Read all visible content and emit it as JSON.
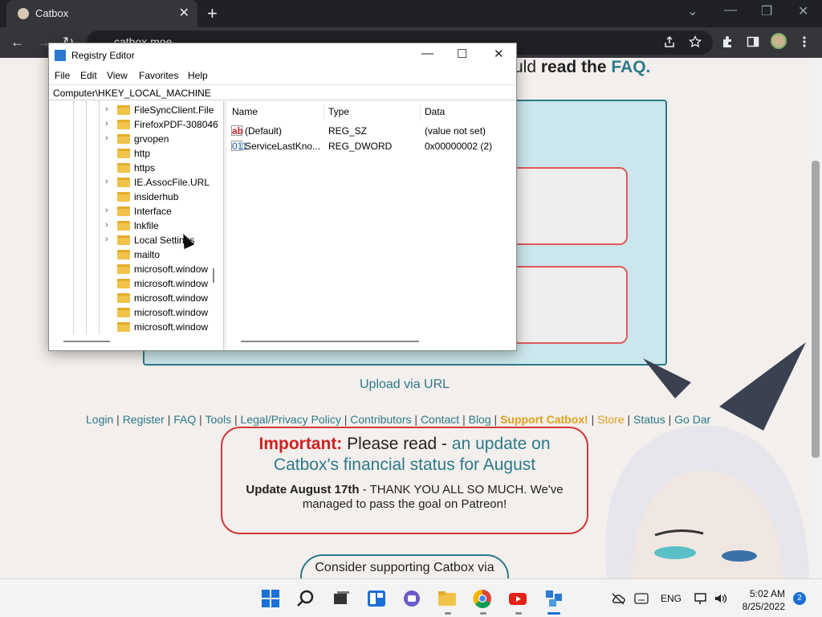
{
  "browser": {
    "tab_title": "Catbox",
    "tab_close": "✕",
    "new_tab": "+",
    "url": "catbox.moe",
    "controls": {
      "minimize": "—",
      "restore": "❐",
      "close": "✕",
      "tab_search": "⌄"
    },
    "toolbar": {
      "back": "←",
      "forward": "→",
      "reload": "↻"
    }
  },
  "page": {
    "faq_prefix": "uld ",
    "faq_bold": "read the ",
    "faq_link": "FAQ.",
    "upload_url": "Upload via URL",
    "links": [
      {
        "label": "Login",
        "kind": "l"
      },
      {
        "label": "Register",
        "kind": "l"
      },
      {
        "label": "FAQ",
        "kind": "l"
      },
      {
        "label": "Tools",
        "kind": "l"
      },
      {
        "label": "Legal/Privacy Policy",
        "kind": "l"
      },
      {
        "label": "Contributors",
        "kind": "l"
      },
      {
        "label": "Contact",
        "kind": "l"
      },
      {
        "label": "Blog",
        "kind": "l"
      },
      {
        "label": "Support Catbox!",
        "kind": "s"
      },
      {
        "label": "Store",
        "kind": "st"
      },
      {
        "label": "Status",
        "kind": "l"
      },
      {
        "label": "Go Dar",
        "kind": "l"
      }
    ],
    "important": {
      "label": "Important:",
      "text": " Please read - ",
      "link": "an update on Catbox's financial status for August",
      "update_bold": "Update August 17th",
      "update_text": " - THANK YOU ALL SO MUCH. We've managed to pass the goal on Patreon!"
    },
    "consider": "Consider supporting Catbox via"
  },
  "regedit": {
    "title": "Registry Editor",
    "menu": [
      "File",
      "Edit",
      "View",
      "Favorites",
      "Help"
    ],
    "address": "Computer\\HKEY_LOCAL_MACHINE",
    "tree": [
      {
        "label": "FileSyncClient.File",
        "expandable": true
      },
      {
        "label": "FirefoxPDF-308046",
        "expandable": true
      },
      {
        "label": "grvopen",
        "expandable": true
      },
      {
        "label": "http",
        "expandable": false
      },
      {
        "label": "https",
        "expandable": false
      },
      {
        "label": "IE.AssocFile.URL",
        "expandable": true
      },
      {
        "label": "insiderhub",
        "expandable": false
      },
      {
        "label": "Interface",
        "expandable": true
      },
      {
        "label": "lnkfile",
        "expandable": true
      },
      {
        "label": "Local Settings",
        "expandable": true
      },
      {
        "label": "mailto",
        "expandable": false
      },
      {
        "label": "microsoft.window",
        "expandable": false
      },
      {
        "label": "microsoft.window",
        "expandable": false
      },
      {
        "label": "microsoft.window",
        "expandable": false
      },
      {
        "label": "microsoft.window",
        "expandable": false
      },
      {
        "label": "microsoft.window",
        "expandable": false
      }
    ],
    "columns": [
      "Name",
      "Type",
      "Data"
    ],
    "values": [
      {
        "icon": "ab",
        "name": "(Default)",
        "type": "REG_SZ",
        "data": "(value not set)"
      },
      {
        "icon": "011",
        "name": "ServiceLastKno...",
        "type": "REG_DWORD",
        "data": "0x00000002 (2)"
      }
    ]
  },
  "taskbar": {
    "lang": "ENG",
    "time": "5:02 AM",
    "date": "8/25/2022",
    "badge": "2"
  }
}
